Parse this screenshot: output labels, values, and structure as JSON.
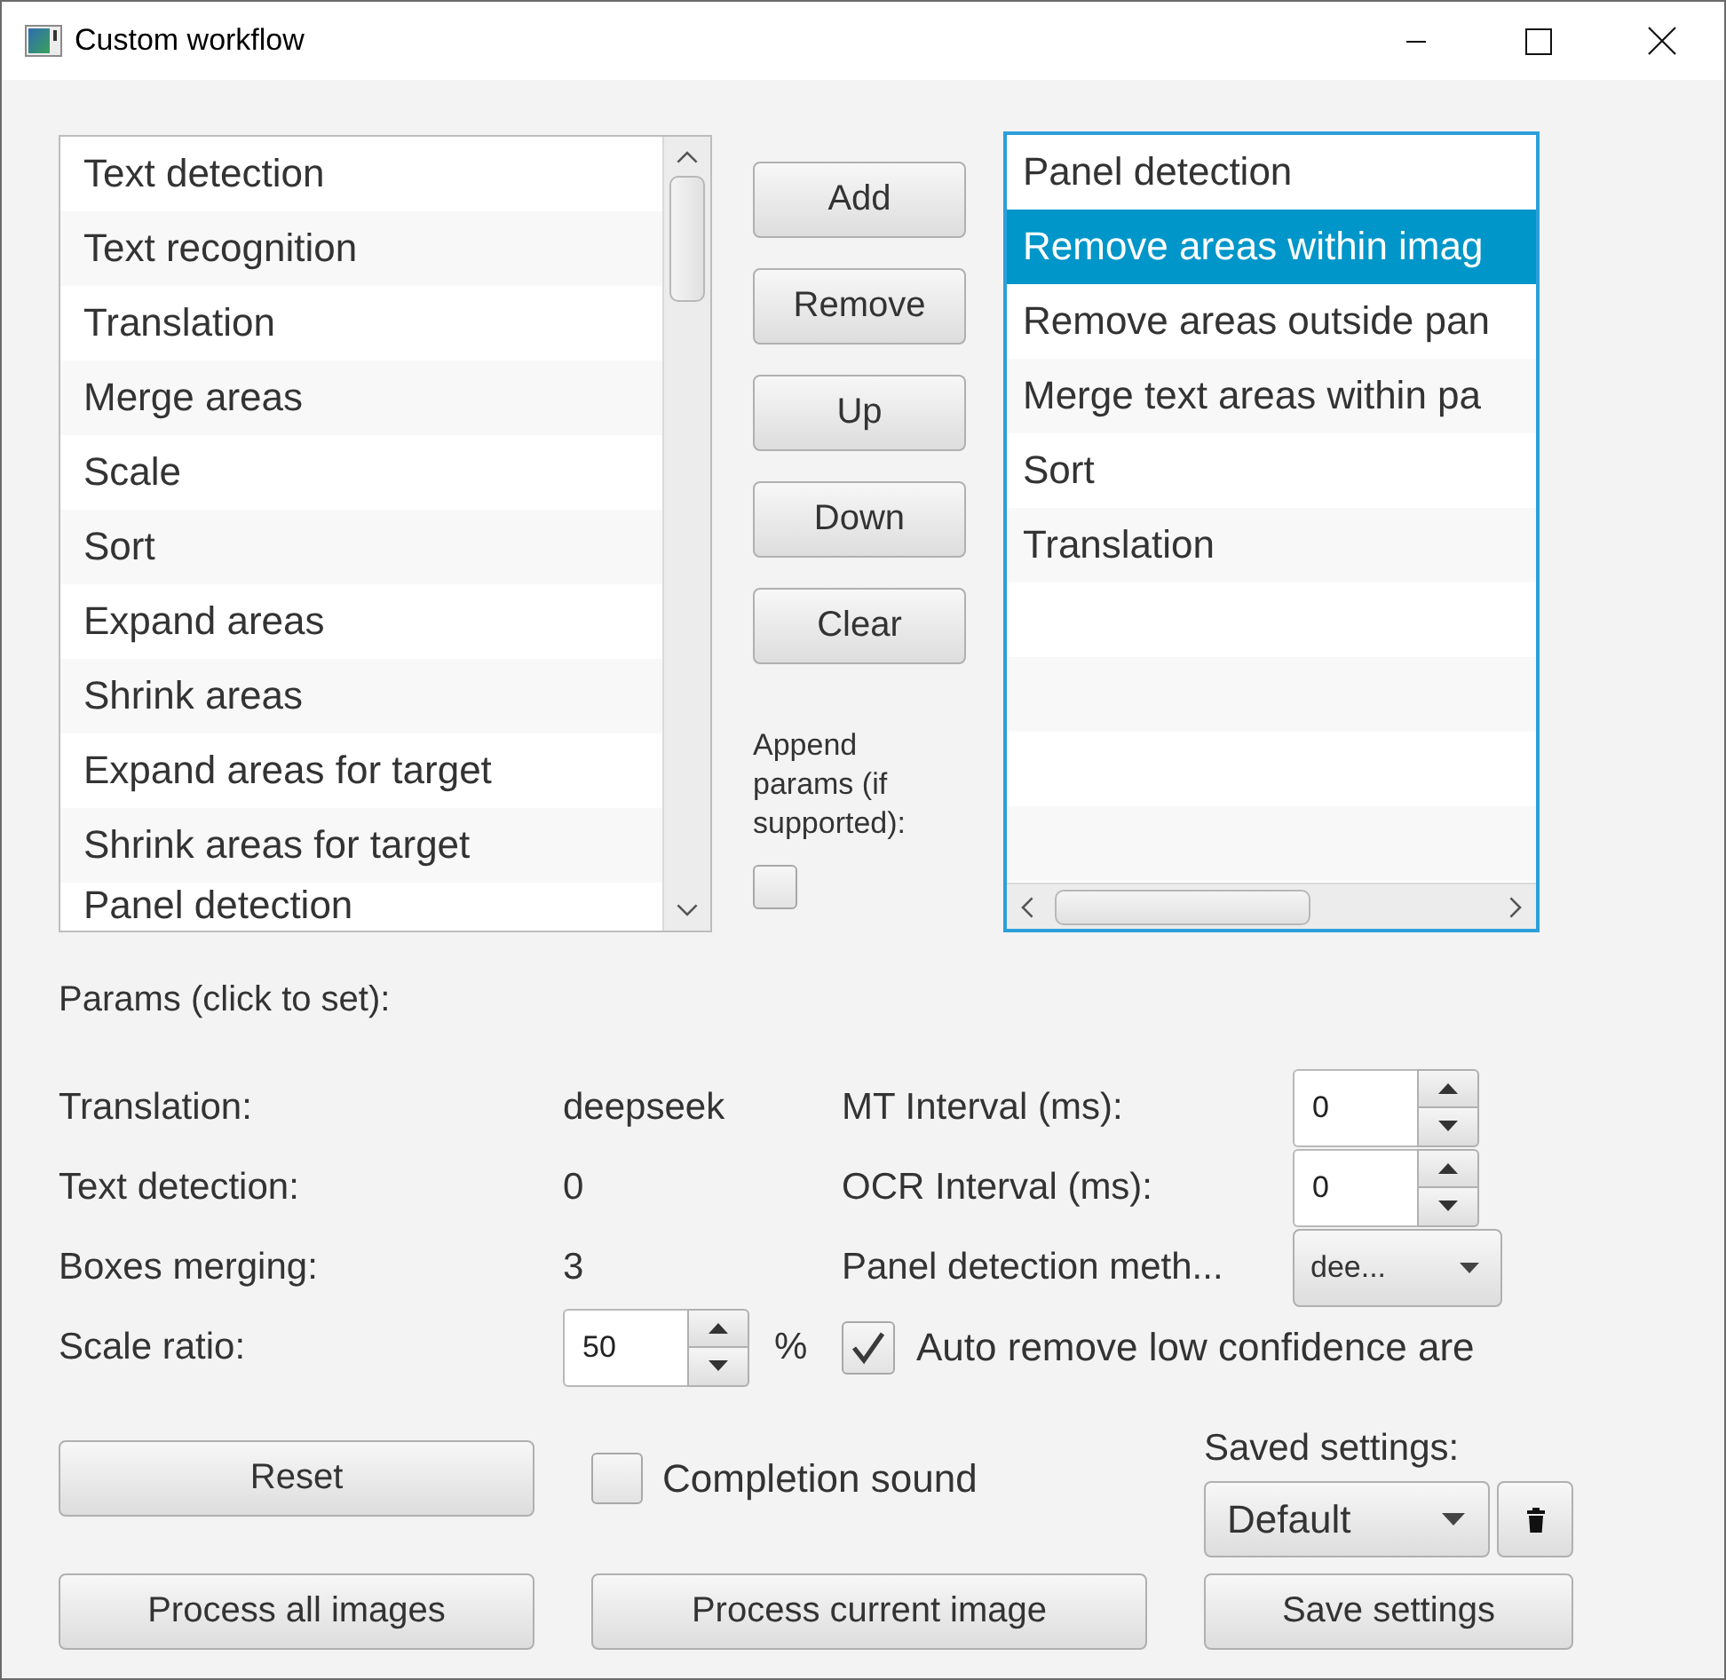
{
  "window": {
    "title": "Custom workflow"
  },
  "available_steps": [
    {
      "label": "Text detection",
      "selected": false
    },
    {
      "label": "Text recognition",
      "selected": false
    },
    {
      "label": "Translation",
      "selected": false
    },
    {
      "label": "Merge areas",
      "selected": false
    },
    {
      "label": "Scale",
      "selected": false
    },
    {
      "label": "Sort",
      "selected": false
    },
    {
      "label": "Expand areas",
      "selected": false
    },
    {
      "label": "Shrink areas",
      "selected": false
    },
    {
      "label": "Expand areas for target",
      "selected": false
    },
    {
      "label": "Shrink areas for target",
      "selected": false
    },
    {
      "label": "Panel detection",
      "selected": false
    }
  ],
  "step_buttons": [
    "Add",
    "Remove",
    "Up",
    "Down",
    "Clear"
  ],
  "append_params": {
    "label": "Append params (if supported):",
    "checked": false
  },
  "workflow_steps": [
    {
      "label": "Panel detection",
      "selected": false
    },
    {
      "label": "Remove areas within imag",
      "selected": true
    },
    {
      "label": "Remove areas outside pan",
      "selected": false
    },
    {
      "label": "Merge text areas within pa",
      "selected": false
    },
    {
      "label": "Sort",
      "selected": false
    },
    {
      "label": "Translation",
      "selected": false
    }
  ],
  "params": {
    "heading": "Params (click to set):",
    "left": [
      {
        "kind": "value",
        "label": "Translation:",
        "value": "deepseek"
      },
      {
        "kind": "value",
        "label": "Text detection:",
        "value": "0"
      },
      {
        "kind": "value",
        "label": "Boxes merging:",
        "value": "3"
      },
      {
        "kind": "spinner",
        "label": "Scale ratio:",
        "value": "50",
        "unit": "%"
      }
    ],
    "right": [
      {
        "kind": "spinner",
        "label": "MT Interval (ms):",
        "value": "0"
      },
      {
        "kind": "spinner",
        "label": "OCR Interval (ms):",
        "value": "0"
      },
      {
        "kind": "dropdown",
        "label": "Panel detection meth...",
        "value": "dee..."
      },
      {
        "kind": "checkbox",
        "label": "Auto remove low confidence are",
        "checked": true
      }
    ]
  },
  "completion_sound": {
    "label": "Completion sound",
    "checked": false
  },
  "saved_settings": {
    "label": "Saved settings:",
    "value": "Default"
  },
  "buttons": {
    "reset": "Reset",
    "process_all": "Process all images",
    "process_current": "Process current image",
    "save": "Save settings"
  }
}
